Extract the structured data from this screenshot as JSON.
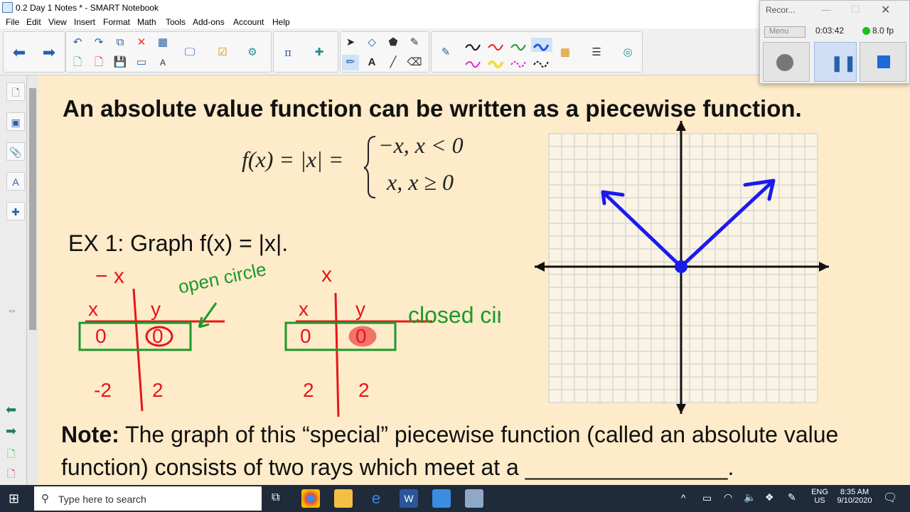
{
  "window": {
    "title": "0.2 Day 1 Notes * - SMART Notebook"
  },
  "menu": [
    "File",
    "Edit",
    "View",
    "Insert",
    "Format",
    "Math",
    "Tools",
    "Add-ons",
    "Account",
    "Help"
  ],
  "page": {
    "heading": "An absolute value function can be written as a piecewise function.",
    "formula_lhs": "f(x) = |x| =",
    "formula_case1": "−x, x < 0",
    "formula_case2": "x, x ≥ 0",
    "example": "EX 1:  Graph f(x) = |x|.",
    "note_label": "Note:",
    "note_text": " The graph of this “special” piecewise function (called an absolute value function) consists of two rays which meet at a ________________.",
    "handwriting": {
      "neg_x": "− x",
      "open_circle": "open circle",
      "closed_circle": "closed circle",
      "x": "x",
      "y": "y",
      "t1_x": "-2",
      "t1_y": "2",
      "t2_x": "2",
      "t2_y": "2",
      "zero": "0"
    }
  },
  "recorder": {
    "title": "Recor...",
    "menu": "Menu",
    "time": "0:03:42",
    "fps": "8.0 fp"
  },
  "taskbar": {
    "search_placeholder": "Type here to search",
    "lang": "ENG",
    "region": "US",
    "time": "8:35 AM",
    "date": "9/10/2020"
  },
  "colors": {
    "canvas": "#fdebc9",
    "graph_line": "#1a1aee",
    "ink_red": "#e8141b",
    "ink_green": "#1a9a2a"
  }
}
